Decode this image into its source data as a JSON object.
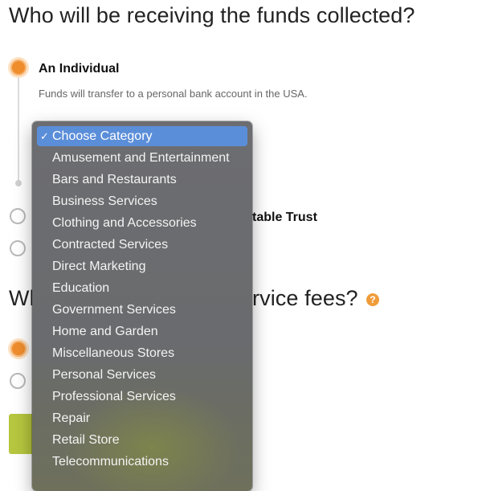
{
  "headings": {
    "funds_question": "Who will be receiving the funds collected?",
    "fees_question_start": "Wh",
    "fees_question_end": "rvice fees?"
  },
  "recipient_options": [
    {
      "label": "An Individual",
      "description": "Funds will transfer to a personal bank account in the USA.",
      "selected": true
    },
    {
      "label_fragment": "table Trust",
      "selected": false
    },
    {
      "label_fragment": "",
      "selected": false
    }
  ],
  "fee_options": [
    {
      "selected": true
    },
    {
      "selected": false
    }
  ],
  "help_icon": {
    "name": "question-mark-icon",
    "glyph": "?"
  },
  "category_dropdown": {
    "selected_index": 0,
    "check_glyph": "✓",
    "options": [
      "Choose Category",
      "Amusement and Entertainment",
      "Bars and Restaurants",
      "Business Services",
      "Clothing and Accessories",
      "Contracted Services",
      "Direct Marketing",
      "Education",
      "Government Services",
      "Home and Garden",
      "Miscellaneous Stores",
      "Personal Services",
      "Professional Services",
      "Repair",
      "Retail Store",
      "Telecommunications"
    ]
  },
  "colors": {
    "accent_orange": "#ef8d2d",
    "highlight_blue": "#5b8ed9",
    "button_green": "#b6c63f"
  }
}
